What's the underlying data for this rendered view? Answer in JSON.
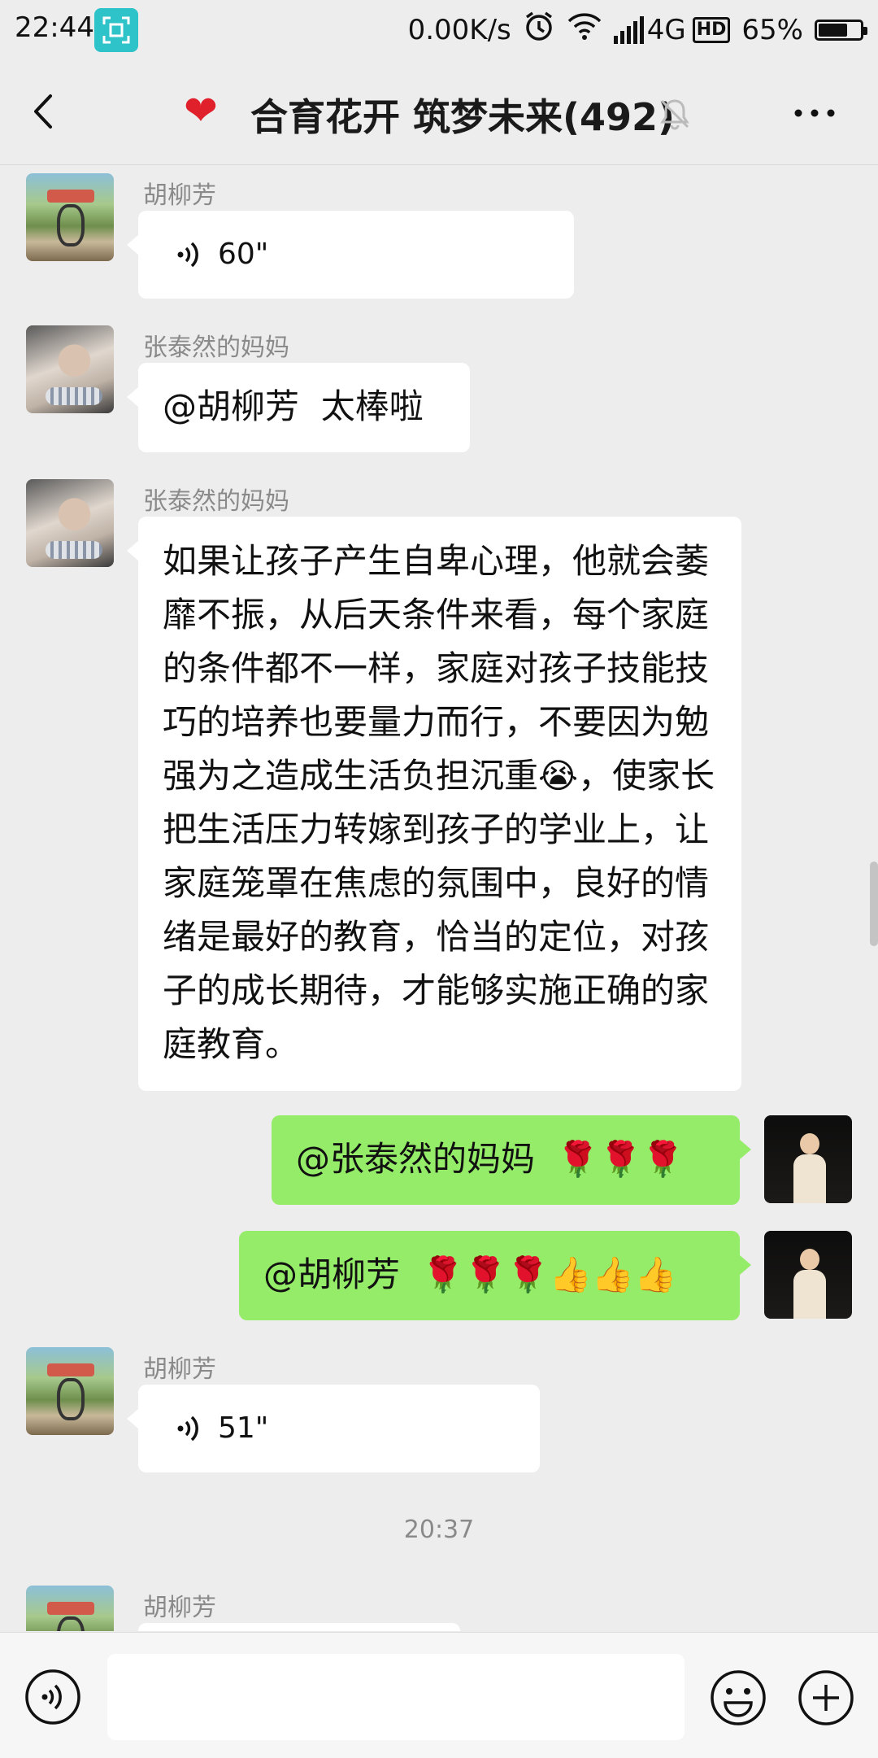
{
  "status_bar": {
    "time": "22:44",
    "network_speed": "0.00K/s",
    "network_type": "4G",
    "hd_label": "HD",
    "battery_percent": "65%",
    "battery_level": 0.65,
    "icons": [
      "screenshot-icon",
      "alarm-icon",
      "wifi-icon",
      "signal-icon",
      "battery-icon"
    ]
  },
  "header": {
    "heart": "❤",
    "title": "合育花开 筑梦未来(492)",
    "icons": [
      "back-icon",
      "mute-bell-icon",
      "more-icon"
    ]
  },
  "messages": [
    {
      "sender": "胡柳芳",
      "type": "voice",
      "duration": "60\""
    },
    {
      "sender": "张泰然的妈妈",
      "type": "text",
      "text": "@胡柳芳  太棒啦"
    },
    {
      "sender": "张泰然的妈妈",
      "type": "text",
      "text": "如果让孩子产生自卑心理，他就会萎靡不振，从后天条件来看，每个家庭的条件都不一样，家庭对孩子技能技巧的培养也要量力而行，不要因为勉强为之造成生活负担沉重😭，使家长把生活压力转嫁到孩子的学业上，让家庭笼罩在焦虑的氛围中，良好的情绪是最好的教育，恰当的定位，对孩子的成长期待，才能够实施正确的家庭教育。"
    },
    {
      "sender": "self",
      "type": "text",
      "text": "@张泰然的妈妈  🌹🌹🌹"
    },
    {
      "sender": "self",
      "type": "text",
      "text": "@胡柳芳  🌹🌹🌹👍👍👍"
    },
    {
      "sender": "胡柳芳",
      "type": "voice",
      "duration": "51\""
    },
    {
      "type": "time",
      "text": "20:37"
    },
    {
      "sender": "胡柳芳",
      "type": "partial"
    }
  ],
  "input_bar": {
    "icons": [
      "voice-input-icon",
      "emoji-icon",
      "plus-icon"
    ]
  }
}
